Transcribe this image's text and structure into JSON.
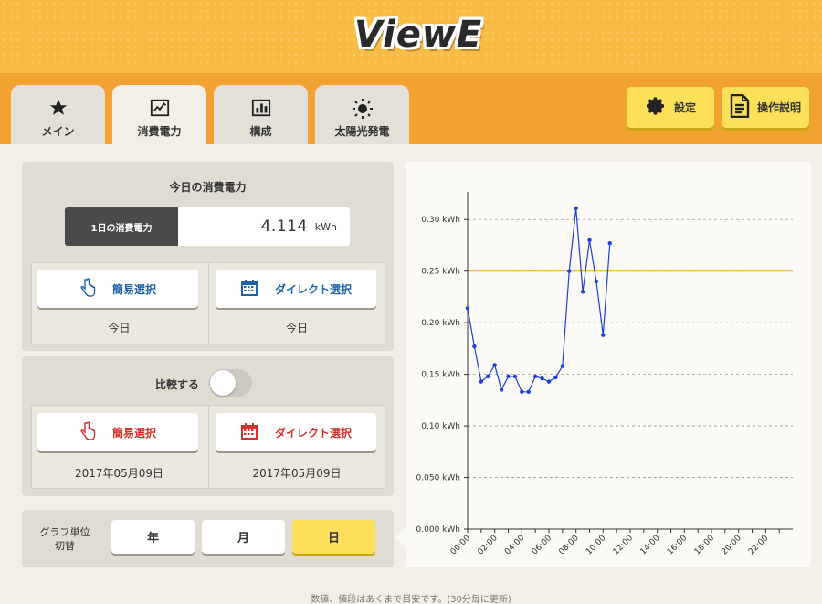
{
  "app": {
    "logo": "ViewE"
  },
  "tabs": [
    {
      "label": "メイン",
      "icon": "star-icon",
      "active": false
    },
    {
      "label": "消費電力",
      "icon": "line-chart-icon",
      "active": true
    },
    {
      "label": "構成",
      "icon": "bar-chart-icon",
      "active": false
    },
    {
      "label": "太陽光発電",
      "icon": "sun-icon",
      "active": false
    }
  ],
  "header_buttons": {
    "settings": "設定",
    "manual": "操作説明"
  },
  "today": {
    "title": "今日の消費電力",
    "day_label": "1日の消費電力",
    "value": "4.114",
    "unit": "kWh"
  },
  "selection": {
    "simple_label": "簡易選択",
    "direct_label": "ダイレクト選択",
    "simple_value": "今日",
    "direct_value": "今日"
  },
  "compare": {
    "label": "比較する",
    "enabled": false,
    "simple_label": "簡易選択",
    "direct_label": "ダイレクト選択",
    "simple_value": "2017年05月09日",
    "direct_value": "2017年05月09日"
  },
  "graph_unit": {
    "label_line1": "グラフ単位",
    "label_line2": "切替",
    "options": [
      "年",
      "月",
      "日"
    ],
    "selected": "日"
  },
  "footer": "数値、値段はあくまで目安です。(30分毎に更新)",
  "colors": {
    "header": "#f8bc44",
    "tabbar": "#f2a231",
    "accent_yellow": "#fde05a",
    "line": "#1f3fd6",
    "threshold": "#f0b43c",
    "blue_text": "#1e63a8",
    "red_text": "#d6302a"
  },
  "chart_data": {
    "type": "line",
    "ylabel_unit": "kWh",
    "ylim": [
      0,
      0.325
    ],
    "yticks": [
      "0.000 kWh",
      "0.050 kWh",
      "0.10 kWh",
      "0.15 kWh",
      "0.20 kWh",
      "0.25 kWh",
      "0.30 kWh"
    ],
    "ytick_values": [
      0,
      0.05,
      0.1,
      0.15,
      0.2,
      0.25,
      0.3
    ],
    "xticks": [
      "00:00",
      "02:00",
      "04:00",
      "06:00",
      "08:00",
      "10:00",
      "12:00",
      "14:00",
      "16:00",
      "18:00",
      "20:00",
      "22:00"
    ],
    "x_hours": [
      0,
      0.5,
      1,
      1.5,
      2,
      2.5,
      3,
      3.5,
      4,
      4.5,
      5,
      5.5,
      6,
      6.5,
      7,
      7.5,
      8,
      8.5,
      9,
      9.5,
      10,
      10.5
    ],
    "values": [
      0.214,
      0.177,
      0.143,
      0.148,
      0.159,
      0.135,
      0.148,
      0.148,
      0.133,
      0.133,
      0.148,
      0.146,
      0.143,
      0.147,
      0.158,
      0.25,
      0.311,
      0.23,
      0.28,
      0.24,
      0.188,
      0.277
    ],
    "threshold": 0.25,
    "grid": true
  }
}
